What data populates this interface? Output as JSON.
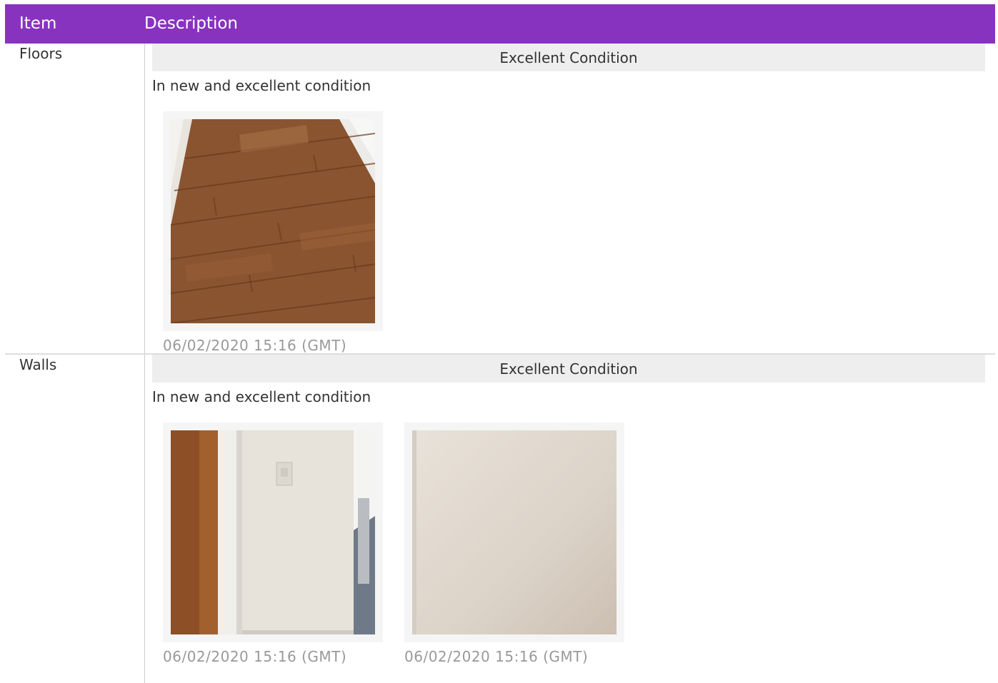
{
  "header": {
    "item_label": "Item",
    "description_label": "Description"
  },
  "colors": {
    "header_bg": "#8833c0",
    "header_text": "#ffffff",
    "condition_bar": "#eeeeee",
    "timestamp": "#999999"
  },
  "rows": [
    {
      "item": "Floors",
      "condition": "Excellent Condition",
      "note": "In new and excellent condition",
      "photos": [
        {
          "subject": "wood-floor",
          "timestamp": "06/02/2020 15:16 (GMT)"
        }
      ]
    },
    {
      "item": "Walls",
      "condition": "Excellent Condition",
      "note": "In new and excellent condition",
      "photos": [
        {
          "subject": "door-wall-switch",
          "timestamp": "06/02/2020 15:16 (GMT)"
        },
        {
          "subject": "plain-wall",
          "timestamp": "06/02/2020 15:16 (GMT)"
        }
      ]
    }
  ]
}
